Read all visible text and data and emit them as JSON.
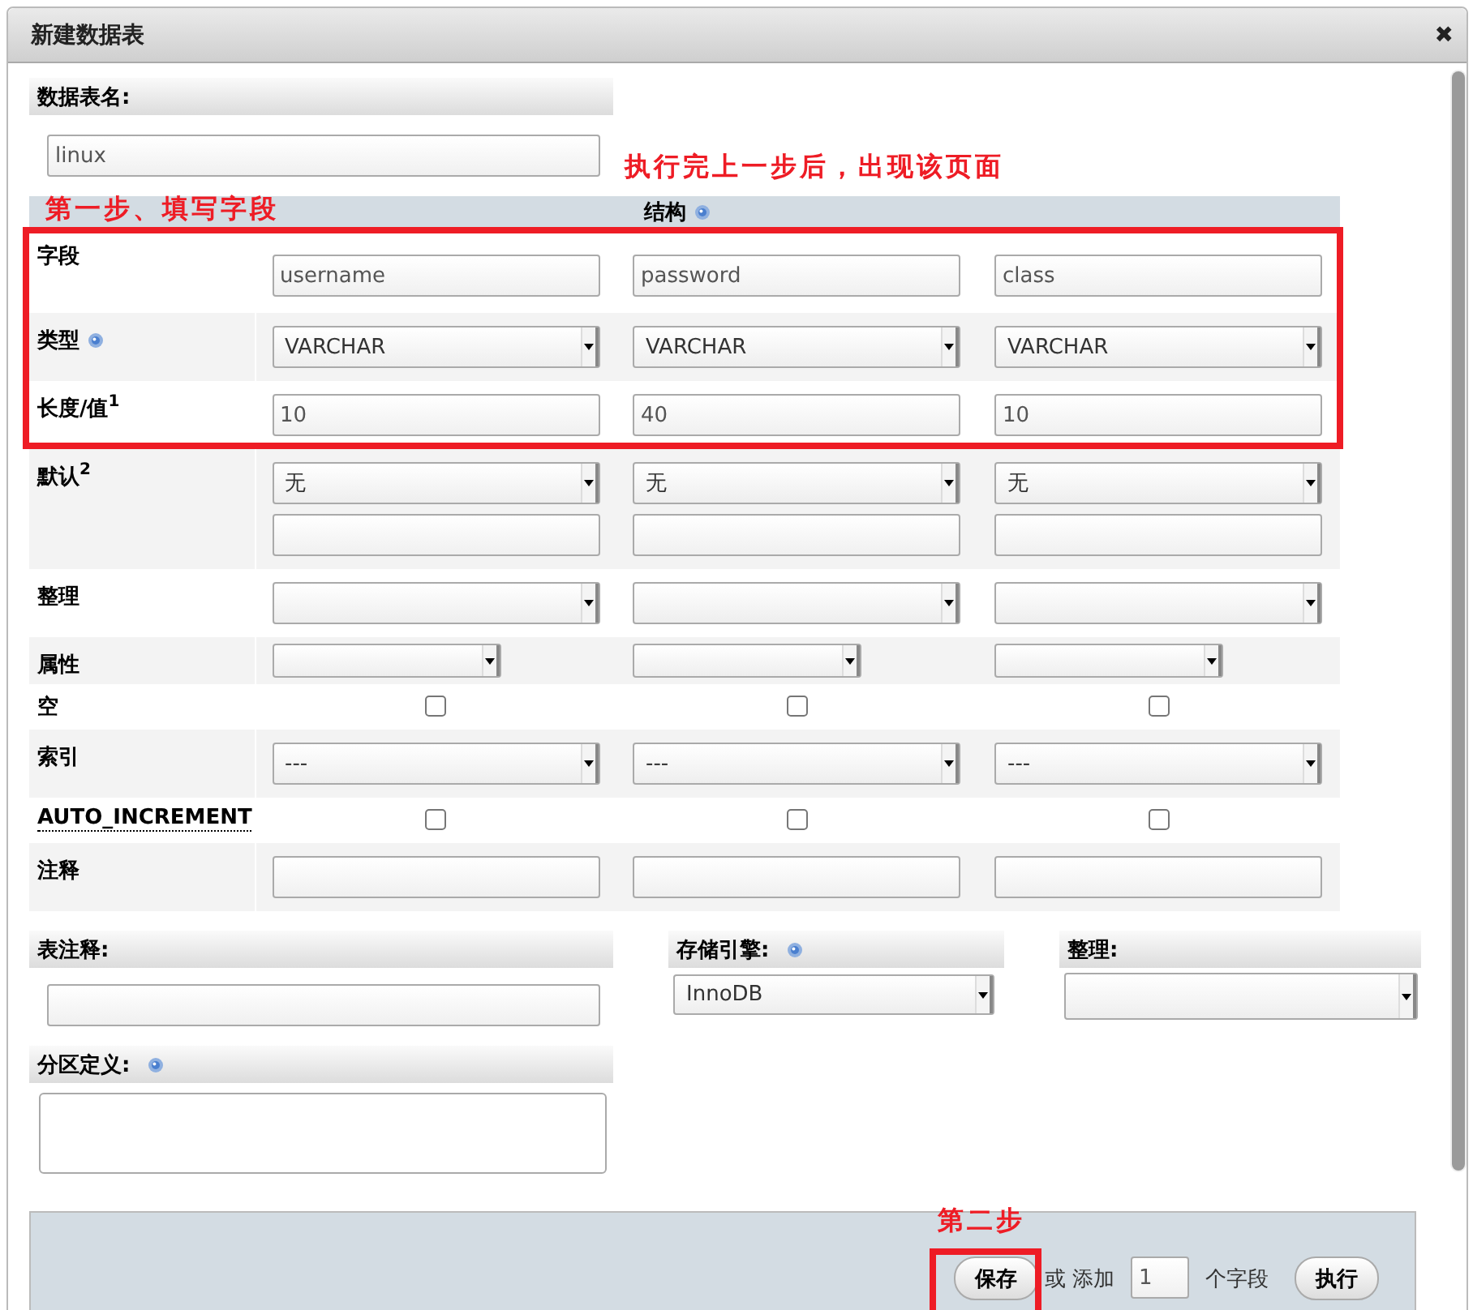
{
  "window": {
    "title": "新建数据表",
    "close": "✖"
  },
  "table_name": {
    "label": "数据表名:",
    "value": "linux"
  },
  "structure": {
    "heading": "结构",
    "help": true,
    "rows": [
      {
        "label": "字段",
        "kind": "text",
        "cells": [
          {
            "value": "username"
          },
          {
            "value": "password"
          },
          {
            "value": "class"
          }
        ]
      },
      {
        "label": "类型",
        "help": true,
        "kind": "select",
        "cells": [
          {
            "value": "VARCHAR"
          },
          {
            "value": "VARCHAR"
          },
          {
            "value": "VARCHAR"
          }
        ]
      },
      {
        "label": "长度/值$^{1}$",
        "kind": "text",
        "cells": [
          {
            "value": "10"
          },
          {
            "value": "40"
          },
          {
            "value": "10"
          }
        ]
      },
      {
        "label": "默认$^{2}$",
        "kind": "select_text",
        "cells": [
          {
            "value": "无"
          },
          {
            "value": "无"
          },
          {
            "value": "无"
          }
        ]
      },
      {
        "label": "整理",
        "kind": "select",
        "cells": [
          {},
          {},
          {}
        ]
      },
      {
        "label": "属性",
        "kind": "short_select",
        "cells": [
          {},
          {},
          {}
        ]
      },
      {
        "label": "空",
        "kind": "checkbox",
        "cells": [
          {
            "checked": false
          },
          {
            "checked": false
          },
          {
            "checked": false
          }
        ]
      },
      {
        "label": "索引",
        "kind": "select",
        "cells": [
          {
            "value": "---"
          },
          {
            "value": "---"
          },
          {
            "value": "---"
          }
        ]
      },
      {
        "label": "AUTO_INCREMENT",
        "tooltip": true,
        "kind": "checkbox",
        "cells": [
          {
            "checked": false
          },
          {
            "checked": false
          },
          {
            "checked": false
          }
        ]
      },
      {
        "label": "注释",
        "kind": "text",
        "cells": [
          {},
          {},
          {}
        ]
      }
    ]
  },
  "table_comment": {
    "label": "表注释:"
  },
  "storage_engine": {
    "label": "存储引擎:",
    "help": true,
    "value": "InnoDB"
  },
  "collation": {
    "label": "整理:"
  },
  "partition": {
    "label": "分区定义:",
    "help": true
  },
  "footer": {
    "save": "保存",
    "or_add": "或 添加",
    "count": "1",
    "unit": "个字段",
    "execute": "执行"
  },
  "annotations": [
    {
      "kind": "note",
      "text": "执行完上一步后，出现该页面"
    },
    {
      "kind": "note",
      "text": "第一步、填写字段"
    },
    {
      "kind": "frame"
    },
    {
      "kind": "note",
      "text": "第二步"
    },
    {
      "kind": "frame"
    }
  ]
}
